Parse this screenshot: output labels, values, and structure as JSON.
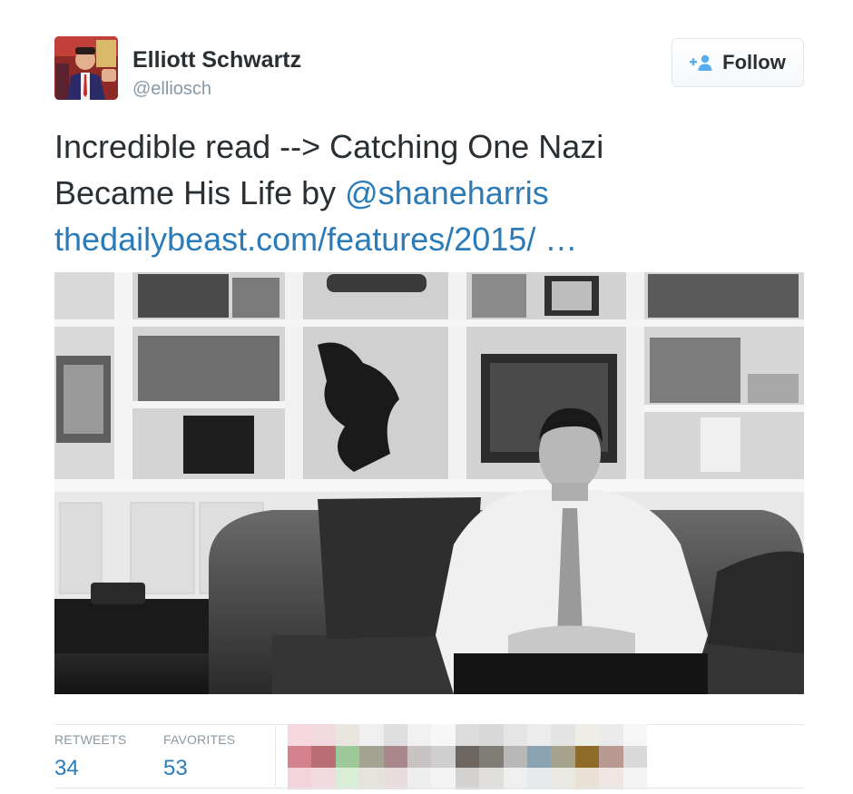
{
  "tweet": {
    "user": {
      "name": "Elliott Schwartz",
      "handle": "@elliosch",
      "avatar_icon": "profile-photo"
    },
    "follow_button": {
      "label": "Follow",
      "icon": "add-user-icon",
      "accent_color": "#55acee"
    },
    "text": {
      "line1": "Incredible read --> Catching One Nazi",
      "line2_prefix": "Became His Life by ",
      "mention": "@shaneharris",
      "url": "thedailybeast.com/features/2015/ …"
    },
    "colors": {
      "link": "#2b7bb9",
      "text": "#292f33",
      "muted": "#8899a6",
      "border": "#e1e8ed"
    },
    "stats": {
      "retweets_label": "RETWEETS",
      "retweets_value": "34",
      "favorites_label": "FAVORITES",
      "favorites_value": "53"
    },
    "favoriters_palette": [
      "#f6d7dd",
      "#f2d9df",
      "#e8e6df",
      "#efefef",
      "#dedede",
      "#f1f1f1",
      "#f7f7f7",
      "#dcdcdc",
      "#d8d8d8",
      "#e5e5e5",
      "#ececec",
      "#e4e4e4",
      "#efeee6",
      "#eaeaea",
      "#f6f6f6",
      "#d5828e",
      "#b86e72",
      "#9ec99a",
      "#a4a493",
      "#a8888c",
      "#c9c4c4",
      "#cfcfcf",
      "#6d6560",
      "#807d77",
      "#b8b8b8",
      "#8aa3b3",
      "#a6a38c",
      "#8f6b2a",
      "#b89a92",
      "#d9d9d9",
      "#f4d4dc",
      "#f2dbdf",
      "#d9eed6",
      "#e4e4dc",
      "#e8dcdc",
      "#eeeeee",
      "#f3f3f3",
      "#d4d2d0",
      "#e0dfdc",
      "#efefef",
      "#e6eaec",
      "#ebeae2",
      "#e9e2d4",
      "#efe6e4",
      "#f3f3f3"
    ]
  }
}
